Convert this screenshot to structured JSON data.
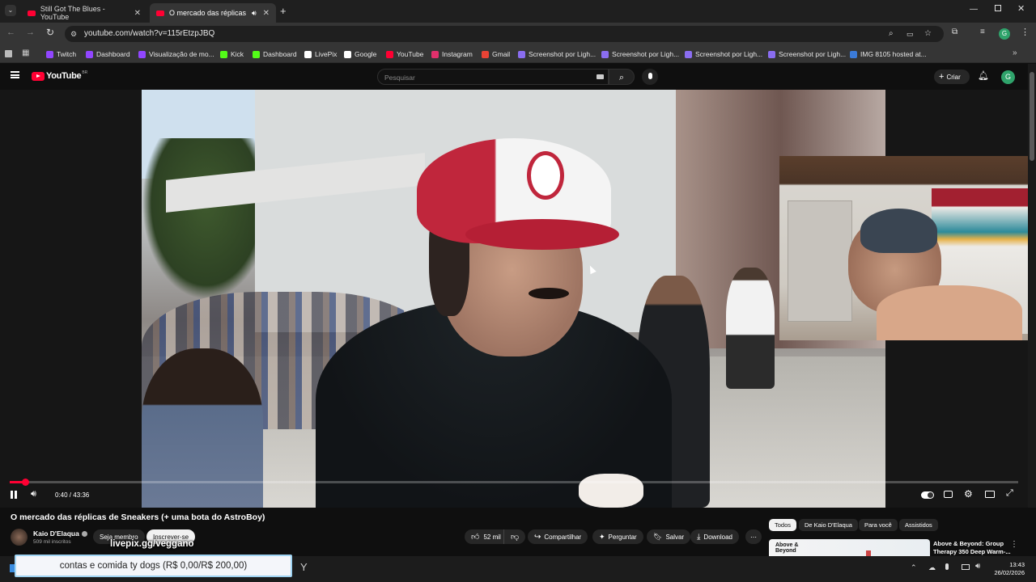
{
  "browser": {
    "tabs": [
      {
        "title": "Still Got The Blues - YouTube"
      },
      {
        "title": "O mercado das réplicas de"
      }
    ],
    "url": "youtube.com/watch?v=115rEtzpJBQ",
    "bookmarks": [
      {
        "label": "Twitch",
        "color": "#9146ff"
      },
      {
        "label": "Dashboard",
        "color": "#9146ff"
      },
      {
        "label": "Visualização de mo...",
        "color": "#9146ff"
      },
      {
        "label": "Kick",
        "color": "#53fc18"
      },
      {
        "label": "Dashboard",
        "color": "#53fc18"
      },
      {
        "label": "LivePix",
        "color": "#ffffff"
      },
      {
        "label": "Google",
        "color": "#ffffff"
      },
      {
        "label": "YouTube",
        "color": "#ff0033"
      },
      {
        "label": "Instagram",
        "color": "#e1306c"
      },
      {
        "label": "Gmail",
        "color": "#ea4335"
      },
      {
        "label": "Screenshot por Ligh...",
        "color": "#8a6df0"
      },
      {
        "label": "Screenshot por Ligh...",
        "color": "#8a6df0"
      },
      {
        "label": "Screenshot por Ligh...",
        "color": "#8a6df0"
      },
      {
        "label": "Screenshot por Ligh...",
        "color": "#8a6df0"
      },
      {
        "label": "IMG 8105 hosted at...",
        "color": "#3b7bd9"
      }
    ]
  },
  "youtube": {
    "logo_text": "YouTube",
    "logo_sup": "BR",
    "search_placeholder": "Pesquisar",
    "create_label": "Criar",
    "avatar_letter": "G"
  },
  "player": {
    "time": "0:40 / 43:36",
    "progress_fraction": 0.0153
  },
  "video": {
    "title": "O mercado das réplicas de Sneakers (+ uma bota do AstroBoy)",
    "channel": "Kaio D'Elaqua",
    "subscribers": "509 mil inscritos",
    "join_label": "Seja membro",
    "subscribe_label": "Inscrever-se",
    "likes": "52 mil",
    "share_label": "Compartilhar",
    "ask_label": "Perguntar",
    "save_label": "Salvar",
    "download_label": "Download"
  },
  "chips": [
    "Todos",
    "De Kaio D'Elaqua",
    "Para você",
    "Assistidos"
  ],
  "recommendation": {
    "thumb_text": "Above & Beyond",
    "title_line1": "Above & Beyond: Group",
    "title_line2": "Therapy 350 Deep Warm-..."
  },
  "overlays": {
    "livepix": "livepix.gg/veggano",
    "donation": "contas e comida ty dogs (R$ 0,00/R$ 200,00)"
  },
  "taskbar": {
    "time": "13:43",
    "date": "26/02/2026"
  }
}
